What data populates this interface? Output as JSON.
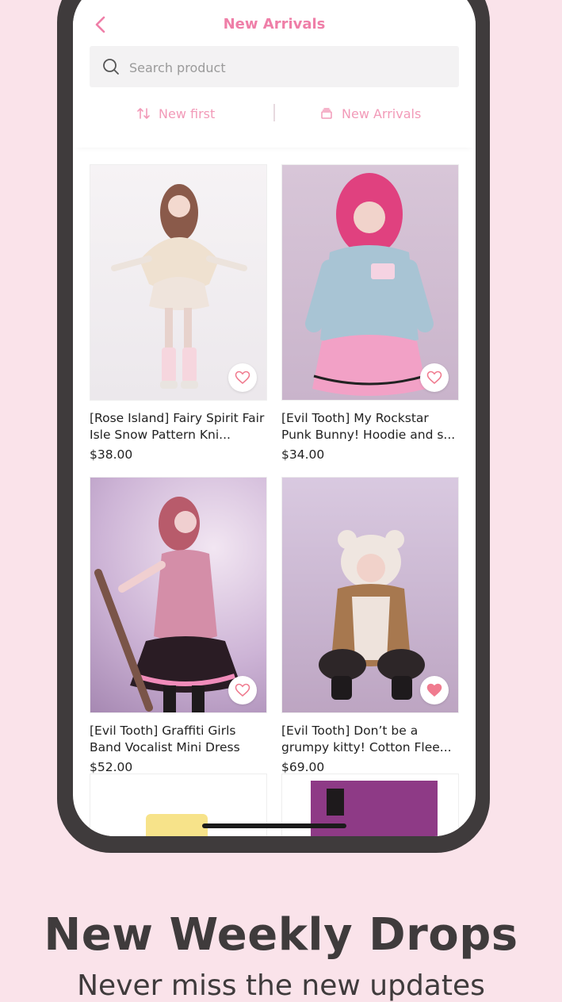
{
  "header": {
    "title": "New Arrivals",
    "back_icon": "chevron-left-icon",
    "search": {
      "placeholder": "Search product",
      "value": "",
      "icon": "search-icon"
    },
    "sort": {
      "label": "New first",
      "icon": "sort-arrows-icon"
    },
    "filter": {
      "label": "New Arrivals",
      "icon": "layers-icon"
    }
  },
  "products": [
    {
      "name": "[Rose Island] Fairy Spirit Fair Isle Snow Pattern Kni...",
      "price": "$38.00",
      "favorited": false
    },
    {
      "name": "[Evil Tooth] My Rockstar Punk Bunny! Hoodie and s...",
      "price": "$34.00",
      "favorited": false
    },
    {
      "name": "[Evil Tooth] Graffiti Girls Band Vocalist Mini Dress",
      "price": "$52.00",
      "favorited": false
    },
    {
      "name": "[Evil Tooth] Don’t be a grumpy kitty! Cotton Flee...",
      "price": "$69.00",
      "favorited": true
    }
  ],
  "promo": {
    "headline": "New Weekly Drops",
    "subline": "Never miss the new updates"
  },
  "colors": {
    "accent": "#ef7fa8",
    "background": "#fae3ea",
    "frame": "#3f3b3c",
    "heart_filled": "#f07b8f"
  }
}
